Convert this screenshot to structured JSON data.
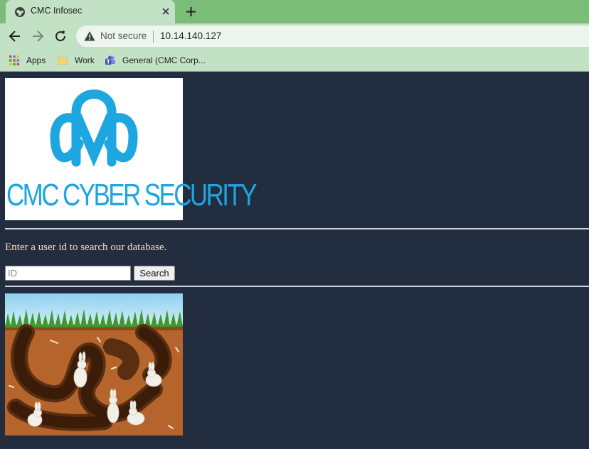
{
  "browser": {
    "tab": {
      "title": "CMC Infosec",
      "favicon": "globe-icon"
    },
    "address_bar": {
      "security_label": "Not secure",
      "url": "10.14.140.127"
    },
    "bookmarks": [
      {
        "label": "Apps",
        "icon": "apps-grid-icon"
      },
      {
        "label": "Work",
        "icon": "folder-icon"
      },
      {
        "label": "General (CMC Corp...",
        "icon": "teams-icon"
      }
    ],
    "colors": {
      "tabstrip": "#7bbd78",
      "toolbar": "#c3e1c4",
      "page_bg": "#222d3f"
    }
  },
  "page": {
    "logo": {
      "text": "CMC CYBER SECURITY",
      "color": "#1ea6e0"
    },
    "prompt": "Enter a user id to search our database.",
    "search": {
      "placeholder": "ID",
      "value": "",
      "button_label": "Search"
    },
    "illustration": {
      "subject": "rabbits in underground burrow"
    }
  }
}
